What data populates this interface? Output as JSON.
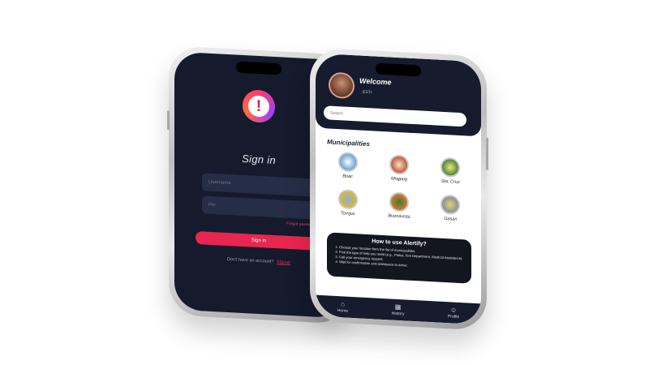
{
  "login": {
    "logo_glyph": "!",
    "title": "Sign in",
    "username_placeholder": "Username",
    "password_placeholder": "Pin",
    "forgot_link": "Forgot password?",
    "signin_button": "Sign in",
    "signup_prompt": "Don't have an account?",
    "signup_link": "Signup",
    "accent_color": "#e8264f"
  },
  "home": {
    "welcome": "Welcome",
    "user_name": "ESTI",
    "search_placeholder": "Search",
    "municipalities_title": "Municipalities",
    "municipalities": [
      {
        "name": "Boac",
        "seal_color": "#6aa6d6"
      },
      {
        "name": "Mogpog",
        "seal_color": "#c35a3a"
      },
      {
        "name": "Sta. Cruz",
        "seal_color": "#4b8a3a"
      },
      {
        "name": "Torrijos",
        "seal_color": "#e0b630"
      },
      {
        "name": "Buenavista",
        "seal_color": "#d07a2a"
      },
      {
        "name": "Gasan",
        "seal_color": "#8a8fa0"
      }
    ],
    "howto": {
      "title": "How to use Alertify?",
      "steps": [
        "Choose your location from the list of municipalities.",
        "Pick the type of help you need (e.g., Police, Fire Department, Medical Assistance).",
        "Call your emergency request.",
        "Wait for confirmation and assistance to arrive."
      ]
    },
    "tabs": [
      {
        "label": "Home",
        "icon": "home-icon"
      },
      {
        "label": "History",
        "icon": "calendar-icon"
      },
      {
        "label": "Profile",
        "icon": "profile-icon"
      }
    ]
  }
}
